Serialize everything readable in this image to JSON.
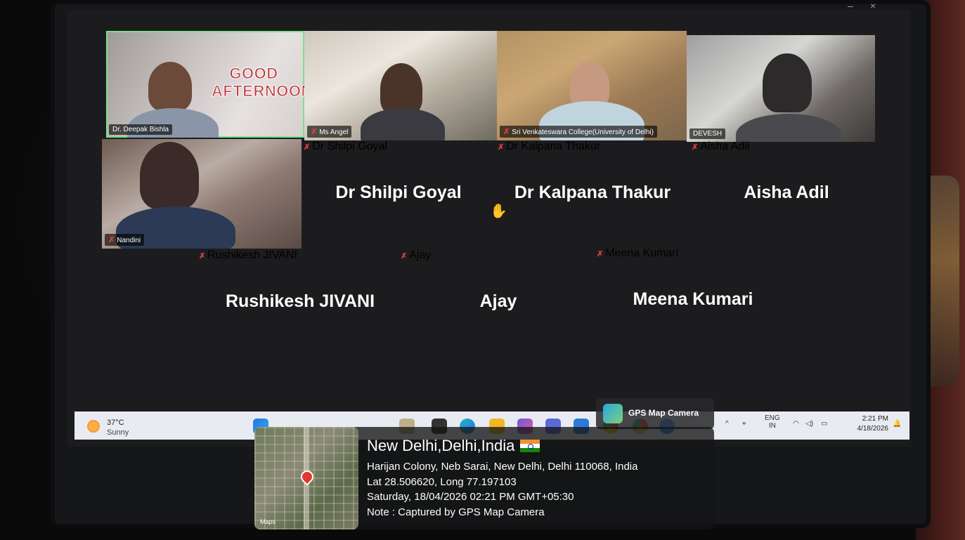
{
  "video_tiles": [
    {
      "name": "Dr. Deepak Bishla",
      "muted": false
    },
    {
      "name": "Ms Angel",
      "muted": true
    },
    {
      "name": "Sri Venkateswara College(University of Delhi)",
      "muted": true
    },
    {
      "name": "DEVESH",
      "muted": false
    },
    {
      "name": "Nandini",
      "muted": true
    }
  ],
  "tile_overlay_text": [
    "GOOD",
    "AFTERNOON"
  ],
  "name_tiles_row1": [
    {
      "big": "Dr Shilpi Goyal",
      "tag": "Dr Shilpi Goyal"
    },
    {
      "big": "Dr Kalpana Thakur",
      "tag": "Dr Kalpana Thakur"
    },
    {
      "big": "Aisha Adil",
      "tag": "Aisha Adil"
    }
  ],
  "name_tiles_row2": [
    {
      "big": "Rushikesh JIVANI",
      "tag": "Rushikesh JIVANI"
    },
    {
      "big": "Ajay",
      "tag": "Ajay"
    },
    {
      "big": "Meena Kumari",
      "tag": "Meena Kumari"
    }
  ],
  "taskbar": {
    "temperature": "37°C",
    "weather": "Sunny",
    "lang_top": "ENG",
    "lang_bottom": "IN",
    "time": "2:21 PM",
    "date": "4/18/2026",
    "tooltip": "GPS Map Camera"
  },
  "gps_overlay": {
    "title": "New Delhi,Delhi,India",
    "address": "Harijan Colony, Neb Sarai, New Delhi, Delhi 110068, India",
    "coords": "Lat 28.506620, Long 77.197103",
    "datetime": "Saturday, 18/04/2026 02:21 PM GMT+05:30",
    "note": "Note : Captured by GPS Map Camera",
    "map_label": "Maps"
  },
  "colors": {
    "mute_icon": "#e0413c",
    "active_speaker_border": "#7ee08a",
    "taskbar_bg": "#e8ecf2"
  }
}
